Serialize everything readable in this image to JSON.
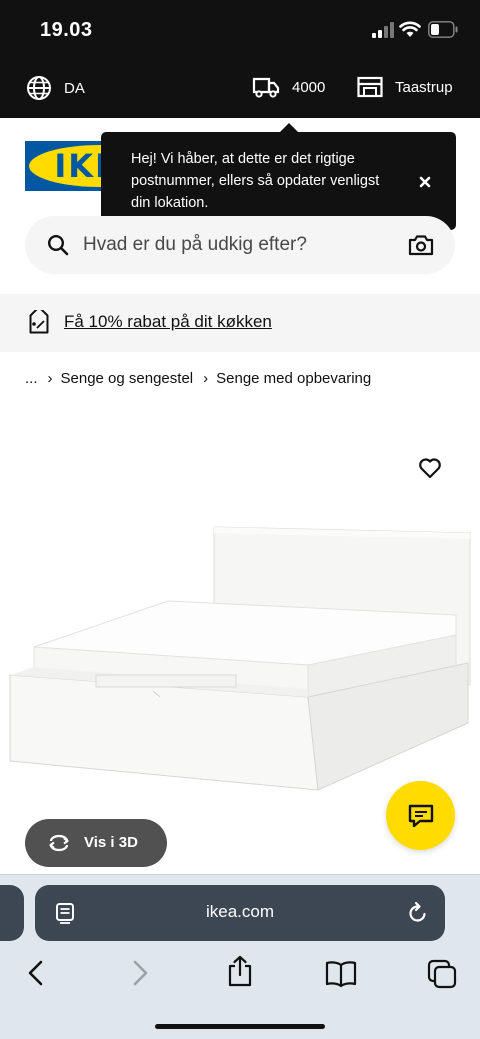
{
  "status": {
    "time": "19.03"
  },
  "topbar": {
    "language": "DA",
    "postcode": "4000",
    "store": "Taastrup"
  },
  "logo": {
    "text": "IKEA"
  },
  "tooltip": {
    "message": "Hej! Vi håber, at dette er det rigtige postnummer, ellers så opdater venligst din lokation."
  },
  "search": {
    "placeholder": "Hvad er du på udkig efter?"
  },
  "promo": {
    "text": "Få 10% rabat på dit køkken"
  },
  "breadcrumb": {
    "ellipsis": "...",
    "items": [
      "Senge og sengestel",
      "Senge med opbevaring"
    ]
  },
  "product": {
    "view3d_label": "Vis i 3D"
  },
  "browser": {
    "url": "ikea.com"
  },
  "colors": {
    "brand_blue": "#0058a3",
    "brand_yellow": "#ffdb00",
    "dark": "#111111"
  }
}
